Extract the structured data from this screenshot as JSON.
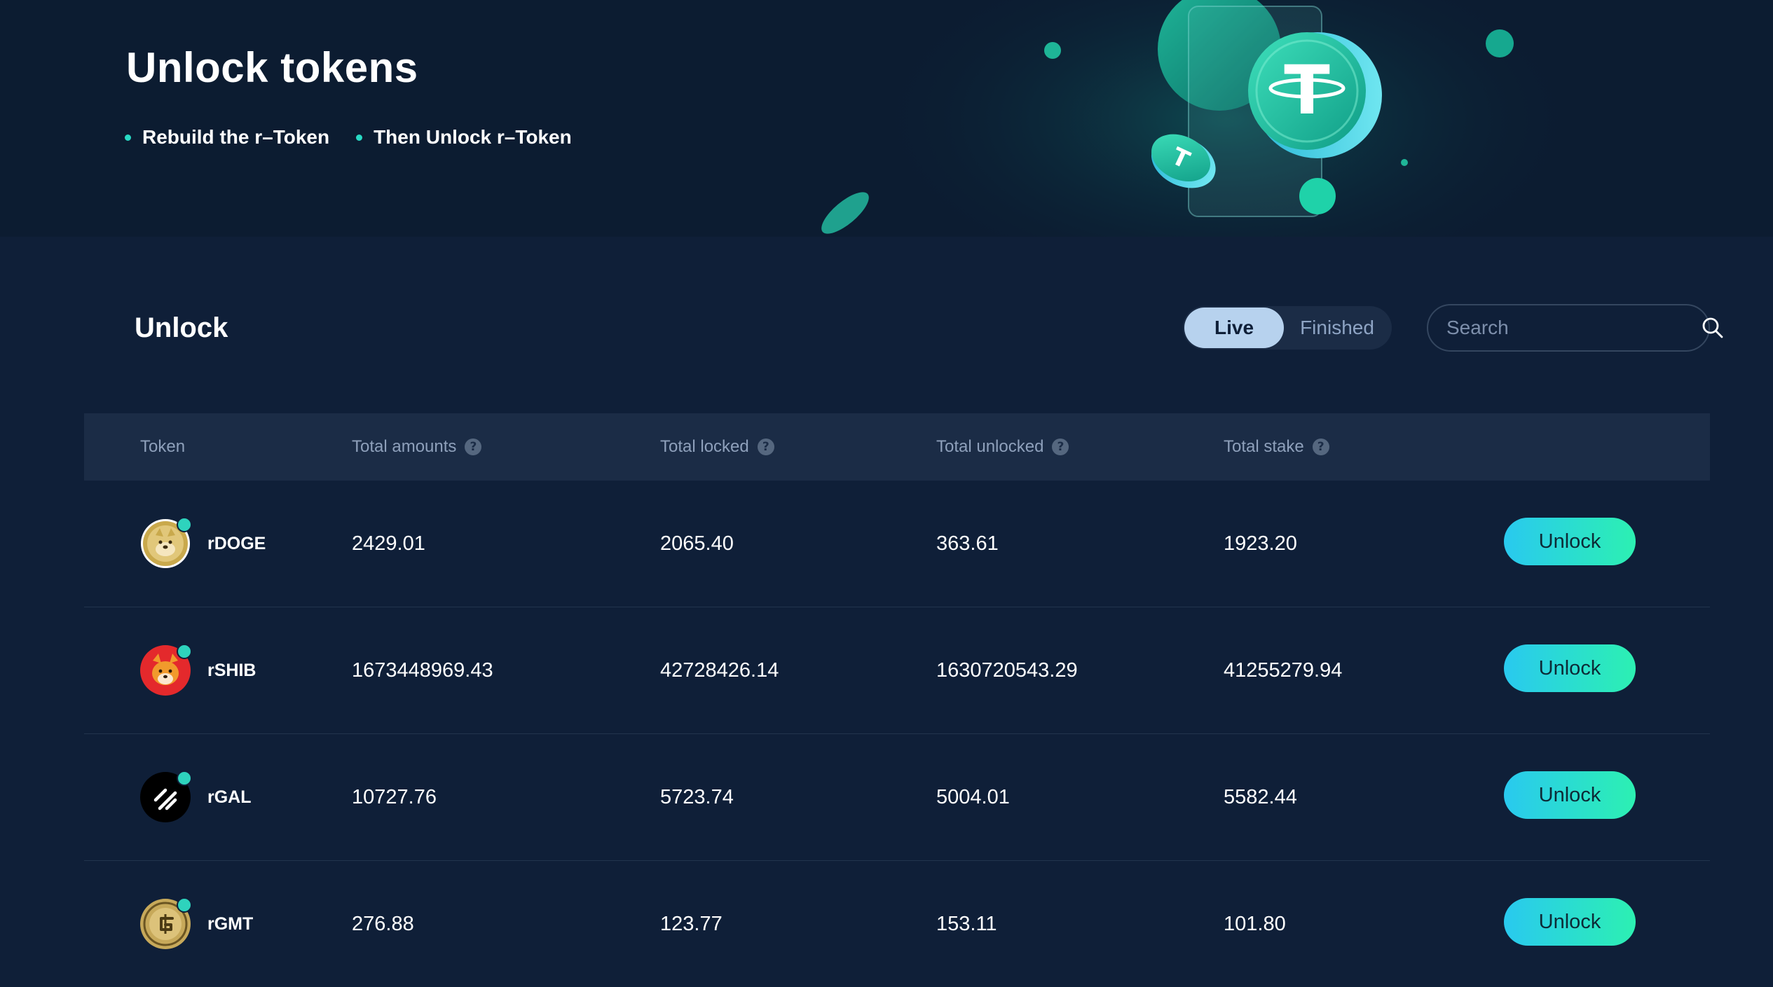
{
  "hero": {
    "title": "Unlock tokens",
    "bullets": [
      "Rebuild the r–Token",
      "Then Unlock r–Token"
    ]
  },
  "section": {
    "title": "Unlock"
  },
  "toggle": {
    "live": "Live",
    "finished": "Finished",
    "selected": "Live"
  },
  "search": {
    "placeholder": "Search",
    "value": ""
  },
  "table": {
    "columns": {
      "token": "Token",
      "total_amounts": "Total amounts",
      "total_locked": "Total locked",
      "total_unlocked": "Total unlocked",
      "total_stake": "Total stake"
    },
    "rows": [
      {
        "token": "rDOGE",
        "total_amounts": "2429.01",
        "total_locked": "2065.40",
        "total_unlocked": "363.61",
        "total_stake": "1923.20",
        "action": "Unlock",
        "icon": "doge-icon"
      },
      {
        "token": "rSHIB",
        "total_amounts": "1673448969.43",
        "total_locked": "42728426.14",
        "total_unlocked": "1630720543.29",
        "total_stake": "41255279.94",
        "action": "Unlock",
        "icon": "shib-icon"
      },
      {
        "token": "rGAL",
        "total_amounts": "10727.76",
        "total_locked": "5723.74",
        "total_unlocked": "5004.01",
        "total_stake": "5582.44",
        "action": "Unlock",
        "icon": "gal-icon"
      },
      {
        "token": "rGMT",
        "total_amounts": "276.88",
        "total_locked": "123.77",
        "total_unlocked": "153.11",
        "total_stake": "101.80",
        "action": "Unlock",
        "icon": "gmt-icon"
      }
    ]
  },
  "colors": {
    "background": "#0f1f38",
    "hero_background": "#0c1c31",
    "accent_teal": "#28d9c4",
    "button_gradient_start": "#29c9ef",
    "button_gradient_end": "#2cf0b2",
    "toggle_active": "#b7d2ee"
  }
}
